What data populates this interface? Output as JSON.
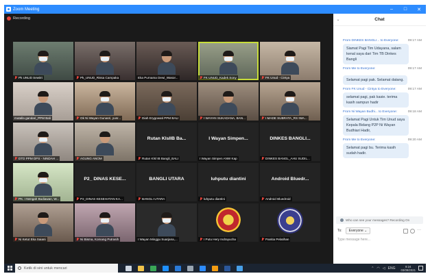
{
  "window": {
    "title": "Zoom Meeting",
    "controls": [
      "–",
      "□",
      "✕"
    ]
  },
  "recording": {
    "label": "Recording"
  },
  "participants": [
    {
      "name": "Pk UNUD Sewitri",
      "muted": true
    },
    {
      "name": "Pk_UNUD_Rissa Campaka",
      "muted": true
    },
    {
      "name": "Eka Purnama Dewi_Wasor...",
      "muted": false
    },
    {
      "name": "FK UNUD_Kadek Sony",
      "muted": true
    },
    {
      "name": "FK Unud - Cintya",
      "muted": true
    },
    {
      "name": "mutalla gandari_PPM Bali",
      "muted": false
    },
    {
      "name": "Ok Ni Wayan Gunasri, yusr...",
      "muted": true
    },
    {
      "name": "Diah Erygowati PPM BALI",
      "muted": true
    },
    {
      "name": "I WAYAN SUKADANA, BAN...",
      "muted": true
    },
    {
      "name": "I MADE SUBRATA_RS IWA...",
      "muted": true
    },
    {
      "name": "DTD PPM DPS - NINDAH ...",
      "muted": true
    },
    {
      "name": "AGUNG ANOM",
      "muted": true
    },
    {
      "name": "Rutan Klsl IB Bangli_BALI",
      "muted": true,
      "display": "Rutan KlsIIB Ba..."
    },
    {
      "name": "I Wayan Simpen ANW Kap",
      "muted": false,
      "display": "I Wayan Simpen..."
    },
    {
      "name": "DINKES BANGL_AHU SUDIL...",
      "muted": true,
      "display": "DINKES BANGLI..."
    },
    {
      "name": "PK. I Nengah Budiawan, W...",
      "muted": true
    },
    {
      "name": "P2_DINAS KESEHATAN KA...",
      "muted": true,
      "display": "P2_ DINAS KESE..."
    },
    {
      "name": "BANGLI UTARA",
      "muted": true,
      "display": "BANGLI UTARA"
    },
    {
      "name": "luhputu diantini",
      "muted": true,
      "display": "luhputu diantini"
    },
    {
      "name": "Android Bluedroid",
      "muted": true,
      "display": "Android Bluedr..."
    },
    {
      "name": "Ni Ketut Eka Saiani",
      "muted": true
    },
    {
      "name": "Ni Bisma, Komang Putrasih",
      "muted": true
    },
    {
      "name": "I Wayan Minggu Suarjana,...",
      "muted": false
    },
    {
      "name": "I Putu Hery Indrayucha",
      "muted": true
    },
    {
      "name": "Panitia Pelatihan",
      "muted": true
    }
  ],
  "chat": {
    "title": "Chat",
    "messages": [
      {
        "from": "From DINKES BANGLI... to Everyone:",
        "time": "09:17 AM",
        "text": "Siamat Pagi Tim Udayana, salam kenal saya dari Tim TB Dinkes Bangli"
      },
      {
        "from": "From Me to Everyone:",
        "time": "09:17 AM",
        "text": "Selamat pagi pak. Selamat datang."
      },
      {
        "from": "From FK Unud - Cintya to Everyone:",
        "time": "09:17 AM",
        "text": "selamat pagi, pak kasie. terima kasih sampun hadir"
      },
      {
        "from": "From Ni Wayan Budhi... to Everyone:",
        "time": "09:18 AM",
        "text": "Selamat Pagi Untuk Tim Unud saya Kepala Bidang P2P Ni Wayan Budhiari Hadir,"
      },
      {
        "from": "From Me to Everyone:",
        "time": "09:20 AM",
        "text": "Selamat pagi bu. Terima kasih sudah hadir."
      }
    ],
    "who_can_see": "Who can see your messages? Recording On",
    "to_label": "To:",
    "to_value": "Everyone",
    "placeholder": "Type message here..."
  },
  "taskbar": {
    "search_placeholder": "Ketik di sini untuk mencari",
    "apps": [
      "task-view",
      "file-explorer",
      "chrome",
      "mail",
      "edge",
      "settings",
      "zoom",
      "vlc",
      "word",
      "store"
    ],
    "app_colors": [
      "#cfd8e3",
      "#f0c34a",
      "#3aa757",
      "#1e90ff",
      "#2b7bd8",
      "#9aa6b2",
      "#2d8cff",
      "#f39c12",
      "#2b579a",
      "#48a0e8"
    ],
    "tray_text": "ENG",
    "time": "9:24",
    "date": "03/09/2021"
  }
}
